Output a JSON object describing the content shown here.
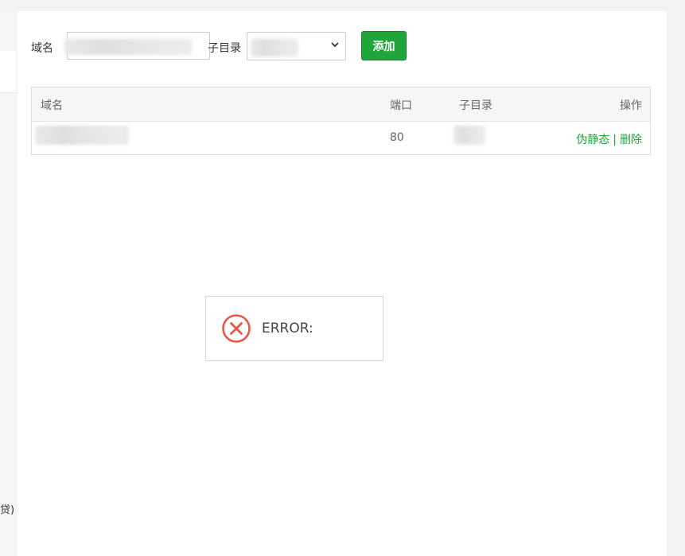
{
  "background": {
    "left_fragment": "贷)"
  },
  "form": {
    "domain_label": "域名",
    "domain_value": "",
    "subdir_label": "子目录",
    "subdir_selected": "",
    "add_button": "添加"
  },
  "table": {
    "headers": [
      "域名",
      "端口",
      "子目录",
      "操作"
    ],
    "rows": [
      {
        "domain": "",
        "port": "80",
        "subdir": "",
        "actions": [
          "伪静态",
          "删除"
        ]
      }
    ],
    "action_separator": "|"
  },
  "error_dialog": {
    "text": "ERROR:",
    "icon": "error-x-circle-icon",
    "icon_color": "#e8584a"
  },
  "colors": {
    "accent": "#20a53a",
    "error": "#e8584a"
  }
}
